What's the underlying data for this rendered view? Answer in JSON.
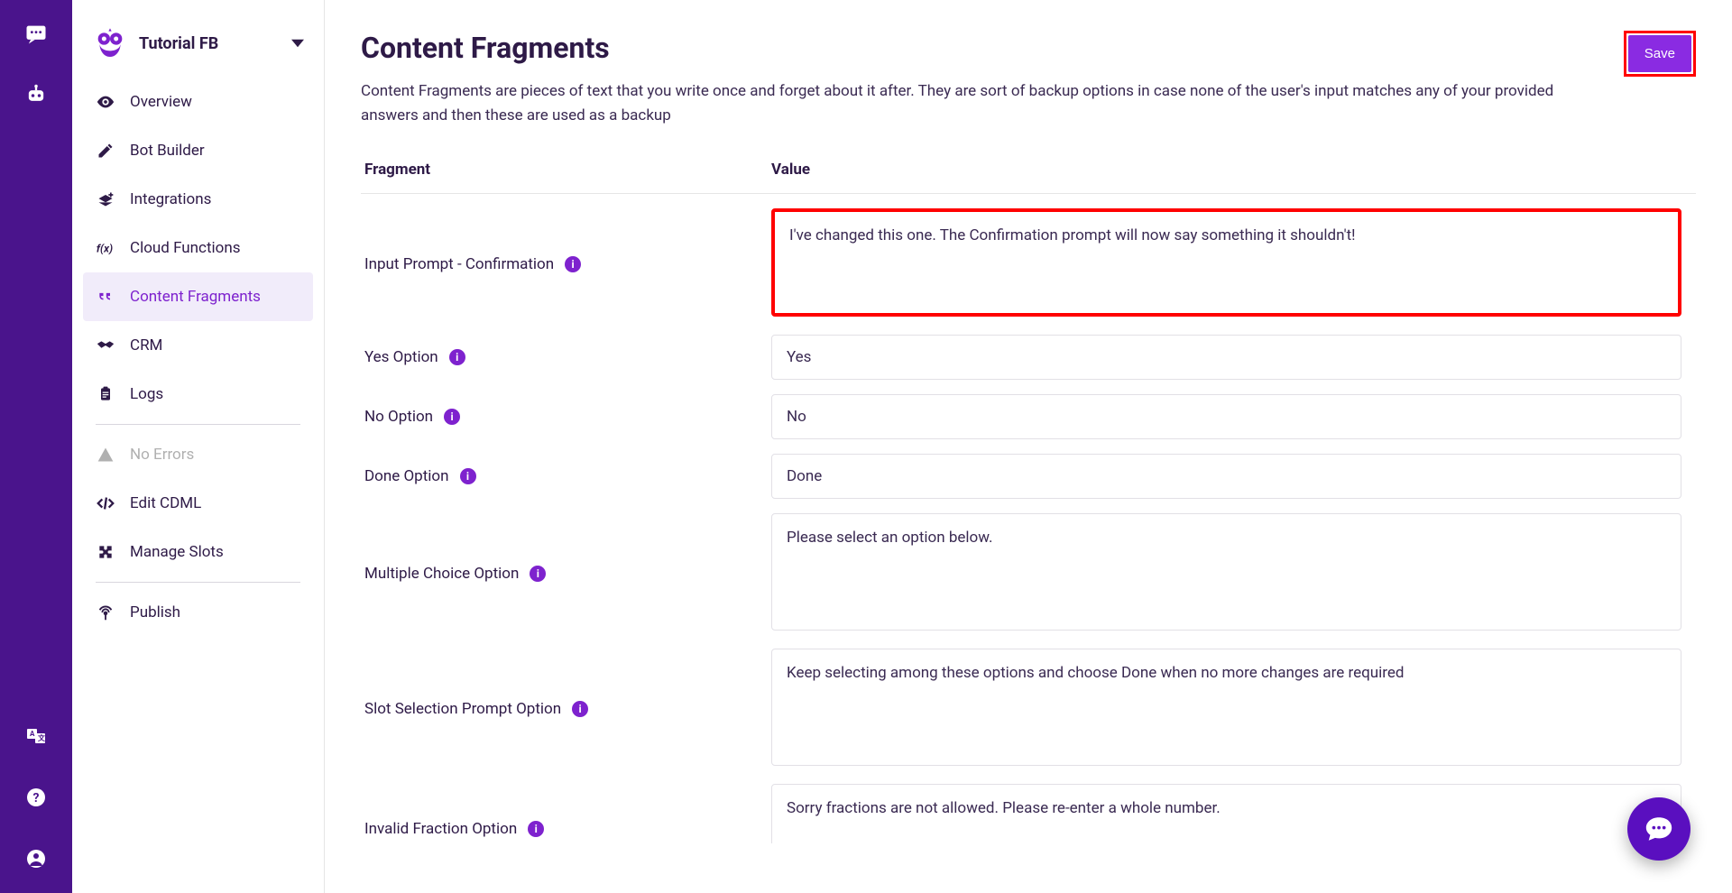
{
  "rail": {},
  "project": {
    "name": "Tutorial FB"
  },
  "sidebar": {
    "items": [
      {
        "label": "Overview"
      },
      {
        "label": "Bot Builder"
      },
      {
        "label": "Integrations"
      },
      {
        "label": "Cloud Functions"
      },
      {
        "label": "Content Fragments"
      },
      {
        "label": "CRM"
      },
      {
        "label": "Logs"
      }
    ],
    "status": {
      "label": "No Errors"
    },
    "tools": [
      {
        "label": "Edit CDML"
      },
      {
        "label": "Manage Slots"
      }
    ],
    "publish": {
      "label": "Publish"
    }
  },
  "page": {
    "title": "Content Fragments",
    "description": "Content Fragments are pieces of text that you write once and forget about it after. They are sort of backup options in case none of the user's input matches any of your provided answers and then these are used as a backup",
    "save_label": "Save",
    "columns": {
      "fragment": "Fragment",
      "value": "Value"
    }
  },
  "fragments": [
    {
      "label": "Input Prompt - Confirmation",
      "value": "I've changed this one. The Confirmation prompt will now say something it shouldn't!",
      "highlight": true,
      "size": "big"
    },
    {
      "label": "Yes Option",
      "value": "Yes",
      "size": "small"
    },
    {
      "label": "No Option",
      "value": "No",
      "size": "small"
    },
    {
      "label": "Done Option",
      "value": "Done",
      "size": "small"
    },
    {
      "label": "Multiple Choice Option",
      "value": "Please select an option below.",
      "size": "med"
    },
    {
      "label": "Slot Selection Prompt Option",
      "value": "Keep selecting among these options and choose Done when no more changes are required",
      "size": "med"
    },
    {
      "label": "Invalid Fraction Option",
      "value": "Sorry fractions are not allowed. Please re-enter a whole number.",
      "size": "big"
    }
  ]
}
